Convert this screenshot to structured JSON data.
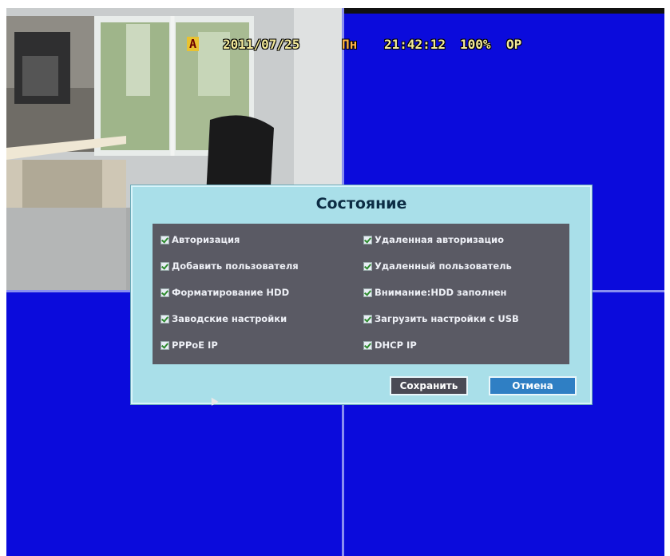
{
  "osd": {
    "channel_flag": "A",
    "date": "2011/07/25",
    "weekday": "Пн",
    "time": "21:42:12",
    "hdd_usage": "100%",
    "mode": "OP"
  },
  "dialog": {
    "title": "Состояние",
    "options": [
      {
        "label": "Авторизация",
        "checked": true
      },
      {
        "label": "Удаленная авторизацио",
        "checked": true
      },
      {
        "label": "Добавить пользователя",
        "checked": true
      },
      {
        "label": "Удаленный пользователь",
        "checked": true
      },
      {
        "label": "Форматирование HDD",
        "checked": true
      },
      {
        "label": "Внимание:HDD заполнен",
        "checked": true
      },
      {
        "label": "Заводские настройки",
        "checked": true
      },
      {
        "label": "Загрузить настройки с USB",
        "checked": true
      },
      {
        "label": "PPPoE IP",
        "checked": true
      },
      {
        "label": "DHCP IP",
        "checked": true
      }
    ],
    "save_label": "Сохранить",
    "cancel_label": "Отмена"
  },
  "colors": {
    "screen_bg": "#0b0bdc",
    "dialog_bg": "#a9dfe9",
    "panel_bg": "#5a5a64",
    "cancel_bg": "#2f7fc4"
  }
}
